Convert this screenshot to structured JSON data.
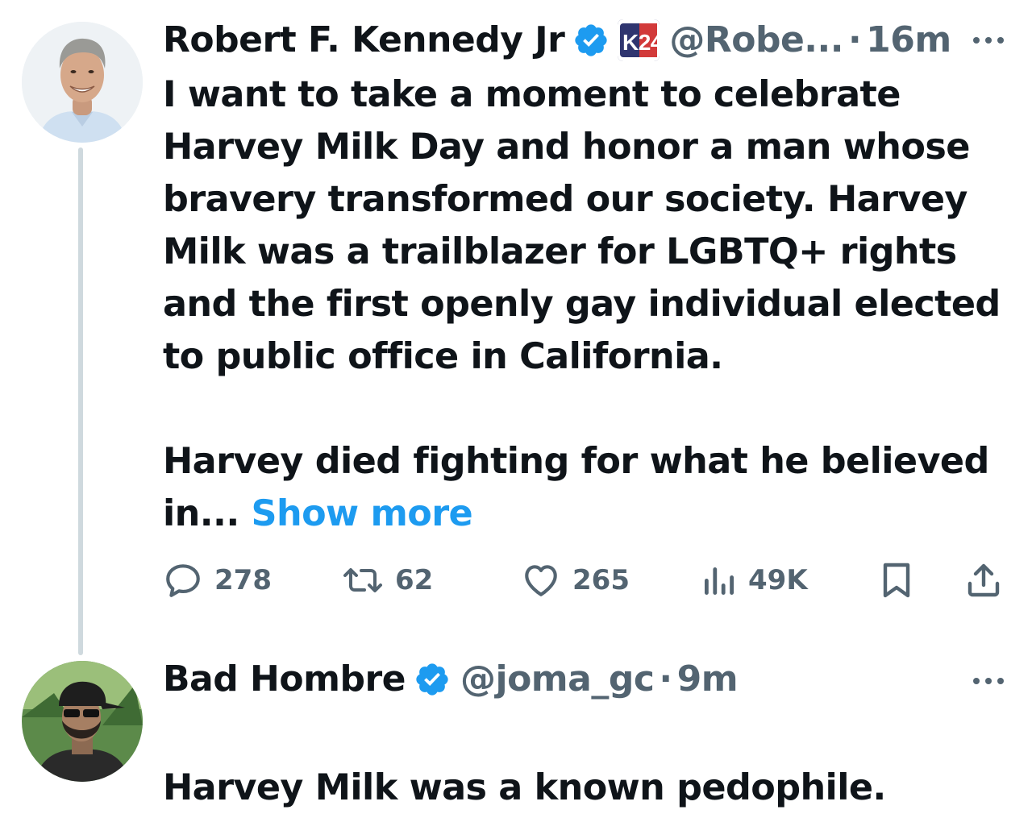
{
  "tweet1": {
    "author_name": "Robert F. Kennedy Jr",
    "handle": "@Robe...",
    "separator": "·",
    "time": "16m",
    "badge_text": "K24",
    "text_lines": "I want to take a moment to celebrate\nHarvey Milk Day and honor a man whose\nbravery transformed our society. Harvey\nMilk was a trailblazer for LGBTQ+ rights\nand the first openly gay individual elected\nto public office in California.\n\nHarvey died fighting for what he believed\nin... ",
    "show_more": "Show more",
    "replies": "278",
    "retweets": "62",
    "likes": "265",
    "views": "49K"
  },
  "tweet2": {
    "author_name": "Bad Hombre",
    "handle": "@joma_gc",
    "separator": "·",
    "time": "9m",
    "text": "Harvey Milk was a known pedophile."
  },
  "colors": {
    "text": "#0f1419",
    "secondary": "#536471",
    "accent": "#1d9bf0",
    "thread_line": "#cfd9de"
  },
  "icons": {
    "verified": "verified-badge-icon",
    "reply": "reply-icon",
    "retweet": "retweet-icon",
    "like": "heart-icon",
    "views": "views-icon",
    "bookmark": "bookmark-icon",
    "share": "share-icon",
    "more": "more-options-icon"
  }
}
